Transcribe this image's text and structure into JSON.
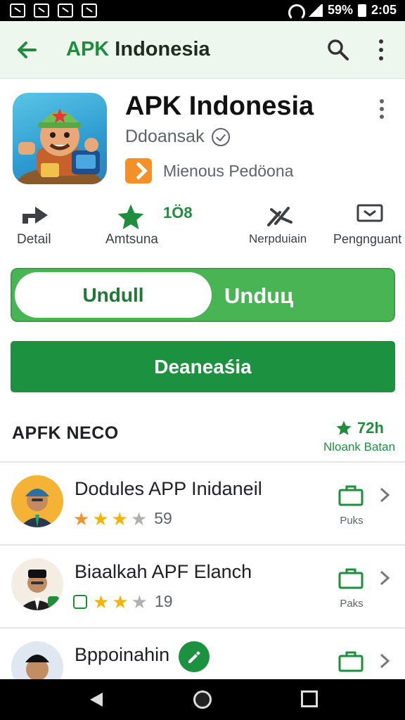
{
  "status_bar": {
    "battery": "59%",
    "time": "2:05"
  },
  "app_bar": {
    "title_green": "APK",
    "title_dark": "Indonesia"
  },
  "app": {
    "name": "APK Indonesia",
    "developer": "Ddoansak",
    "badge_text": "Mienous Pedöona"
  },
  "stats": [
    {
      "label": "Detail",
      "icon": "share-icon"
    },
    {
      "label": "Amtsuna",
      "icon": "star-icon",
      "value": "1Ö8"
    },
    {
      "label": "Nerpduiain",
      "icon": "tools-icon"
    },
    {
      "label": "Pengnguant",
      "icon": "screen-icon"
    }
  ],
  "toggle": {
    "knob_label": "Undull",
    "label": "Unduц"
  },
  "primary_button": {
    "label": "Deaneaśia"
  },
  "section": {
    "title": "APFK NECO",
    "rating": "72h",
    "sub": "Nloank Batan"
  },
  "items": [
    {
      "name": "Dodules APP Inidaneil",
      "count": "59",
      "action_label": "Puks",
      "stars": 4
    },
    {
      "name": "Biaalkah APF Elanch",
      "count": "19",
      "action_label": "Paks",
      "stars": 3
    },
    {
      "name": "Bppoinahin",
      "count": "",
      "action_label": "",
      "stars": 0
    }
  ],
  "colors": {
    "accent": "#1e8e3e",
    "button": "#1c9240",
    "toggle": "#48b454",
    "appbar_bg": "#eef7ee"
  }
}
